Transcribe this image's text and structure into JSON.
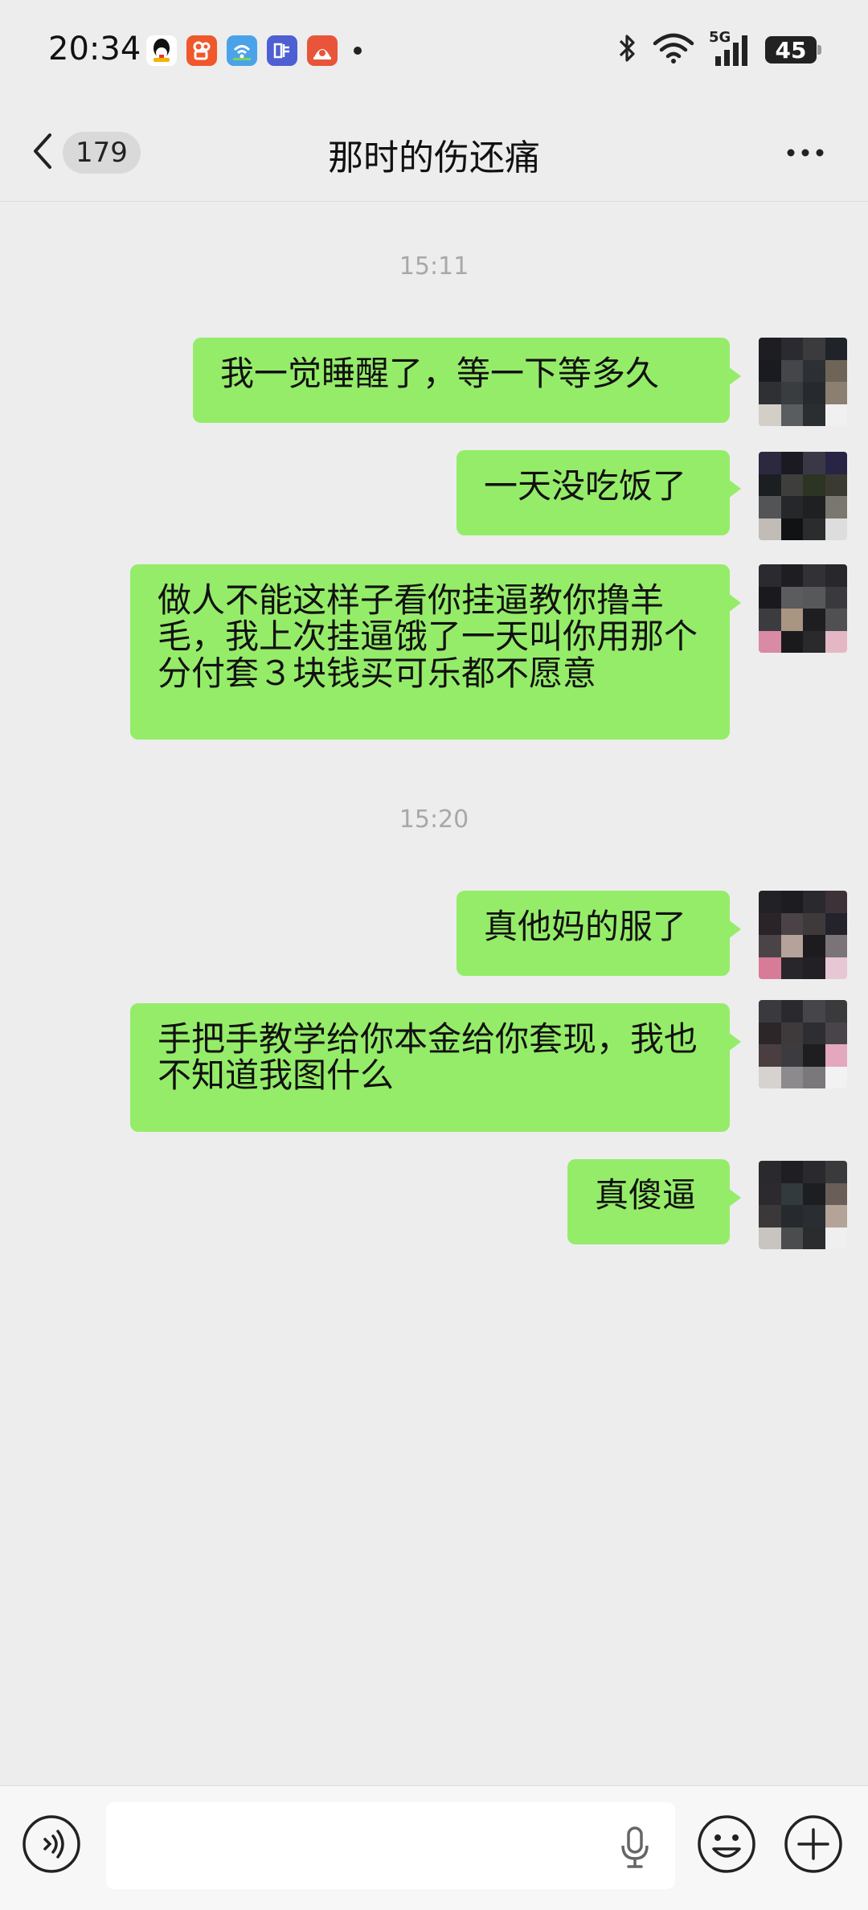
{
  "status_bar": {
    "time": "20:34",
    "notification_icons": [
      "qq-icon",
      "kuaishou-icon",
      "wifi-app-icon",
      "tieba-icon",
      "game-app-icon"
    ],
    "network": "5G",
    "battery": "45"
  },
  "header": {
    "back_badge": "179",
    "title": "那时的伤还痛"
  },
  "messages": {
    "timestamp_1": "15:11",
    "m1": "我一觉睡醒了，等一下等多久",
    "m2": "一天没吃饭了",
    "m3": "做人不能这样子看你挂逼教你撸羊毛，我上次挂逼饿了一天叫你用那个分付套３块钱买可乐都不愿意",
    "timestamp_2": "15:20",
    "m4": "真他妈的服了",
    "m5": "手把手教学给你本金给你套现，我也不知道我图什么",
    "m6": "真傻逼"
  },
  "input_bar": {
    "value": ""
  },
  "colors": {
    "bubble": "#95ec69",
    "background": "#ededed"
  }
}
